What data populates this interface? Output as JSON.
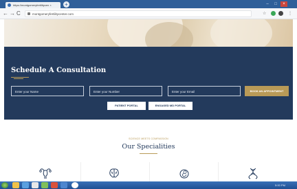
{
  "browser": {
    "tab_title": "https://montgomeryfertilitycen ×",
    "new_tab": "+",
    "url": "montgomeryfertilitycenter.com",
    "nav": {
      "back": "←",
      "forward": "→",
      "reload": "C"
    },
    "window_controls": {
      "minimize": "–",
      "maximize": "□",
      "close": "×"
    },
    "toolbar_icons": {
      "star": "☆",
      "menu": "⋮"
    }
  },
  "consultation": {
    "heading": "Schedule A Consultation",
    "name_placeholder": "Enter your Name",
    "number_placeholder": "Enter your Number",
    "email_placeholder": "Enter your Email",
    "book_button": "BOOK AN APPOINTMENT",
    "patient_portal": "PATIENT PORTAL",
    "engaged_portal": "ENGAGED MD PORTAL"
  },
  "specialities": {
    "kicker": "SCIENCE MEETS COMPASSION",
    "title": "Our Specialities",
    "icons": [
      "uterus-icon",
      "brain-icon",
      "fetus-icon",
      "dna-icon"
    ]
  },
  "taskbar": {
    "time": "5:00 PM"
  },
  "colors": {
    "navy": "#233a5c",
    "gold": "#b99a57",
    "browser_blue": "#2f5f99"
  }
}
